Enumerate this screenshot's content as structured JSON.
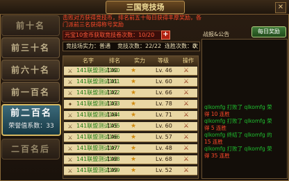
{
  "window": {
    "title": "三国竞技场",
    "close_icon": "close-icon"
  },
  "top_note": "击败对方获得竞技币，排名前五十每日获得丰厚奖励，各门派前三名获得称号奖励",
  "rank_tabs": [
    {
      "label": "前十名",
      "active": false
    },
    {
      "label": "前三十名",
      "active": false
    },
    {
      "label": "前六十名",
      "active": false
    },
    {
      "label": "前一百名",
      "active": false
    },
    {
      "label": "前二百名",
      "sub": "荣誉值系数：33",
      "active": true
    },
    {
      "label": "二百名后",
      "active": false
    }
  ],
  "info": {
    "remaining_text": "元宝10金币获取竞技卷次数：10/20",
    "plus_icon": "plus-icon"
  },
  "stats": {
    "strength_label": "竞技场实力：普通",
    "challenge_label": "竞技次数：22/22",
    "streak_label": "连胜次数：0",
    "streak_suffix": "次"
  },
  "table": {
    "headers": [
      "名字",
      "排名",
      "实力",
      "等级",
      "操作"
    ],
    "rows": [
      {
        "class_icon": "sword-icon",
        "name": "141联盟测试160",
        "rank": "140",
        "level": "Lv. 46"
      },
      {
        "class_icon": "sword-icon",
        "name": "141联盟测试161",
        "rank": "141",
        "level": "Lv. 60"
      },
      {
        "class_icon": "sword-icon",
        "name": "141联盟测试162",
        "rank": "142",
        "level": "Lv. 66"
      },
      {
        "class_icon": "staff-icon",
        "name": "141联盟测试163",
        "rank": "143",
        "level": "Lv. 78"
      },
      {
        "class_icon": "sword-icon",
        "name": "141联盟测试164",
        "rank": "144",
        "level": "Lv. 71"
      },
      {
        "class_icon": "sword-icon",
        "name": "141联盟测试165",
        "rank": "145",
        "level": "Lv. 60"
      },
      {
        "class_icon": "sword-icon",
        "name": "141联盟测试166",
        "rank": "146",
        "level": "Lv. 57"
      },
      {
        "class_icon": "sword-icon",
        "name": "141联盟测试167",
        "rank": "147",
        "level": "Lv. 48"
      },
      {
        "class_icon": "sword-icon",
        "name": "141联盟测试168",
        "rank": "148",
        "level": "Lv. 68"
      },
      {
        "class_icon": "sword-icon",
        "name": "141联盟测试169",
        "rank": "149",
        "level": "Lv. 52"
      }
    ],
    "star_icon": "star-icon",
    "op_icon": "duel-icon"
  },
  "right": {
    "challenge_button": "每日奖励",
    "report_title": "战报&公告",
    "report_lines": [
      {
        "text": "qlkomfg 打败了 qlkomfg 荣",
        "hl": false
      },
      {
        "text": "得 10 连胜",
        "hl": true
      },
      {
        "text": "qlkomfg 打败了 qlkomfg 荣",
        "hl": false
      },
      {
        "text": "得 5 连胜",
        "hl": true
      },
      {
        "text": "qlkomfg 终结了 qlkomfg 的",
        "hl": false
      },
      {
        "text": "15 连胜",
        "hl": true
      },
      {
        "text": "qlkomfg 打败了 qlkomfg 荣",
        "hl": false
      },
      {
        "text": "得 35 连胜",
        "hl": true
      }
    ]
  }
}
